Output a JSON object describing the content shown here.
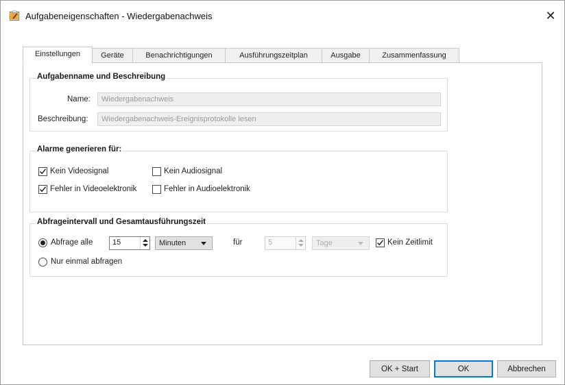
{
  "window": {
    "title": "Aufgabeneigenschaften - Wiedergabenachweis",
    "close_label": "✕"
  },
  "tabs": [
    {
      "label": "Einstellungen",
      "active": true
    },
    {
      "label": "Geräte",
      "active": false
    },
    {
      "label": "Benachrichtigungen",
      "active": false
    },
    {
      "label": "Ausführungszeitplan",
      "active": false
    },
    {
      "label": "Ausgabe",
      "active": false
    },
    {
      "label": "Zusammenfassung",
      "active": false
    }
  ],
  "task_group": {
    "title": "Aufgabenname und Beschreibung",
    "name_label": "Name:",
    "name_value": "Wiedergabenachweis",
    "description_label": "Beschreibung:",
    "description_value": "Wiedergabenachweis-Ereignisprotokolle lesen"
  },
  "alarms_group": {
    "title": "Alarme generieren für:",
    "options": [
      {
        "label": "Kein Videosignal",
        "checked": true
      },
      {
        "label": "Kein Audiosignal",
        "checked": false
      },
      {
        "label": "Fehler in Videoelektronik",
        "checked": true
      },
      {
        "label": "Fehler in Audioelektronik",
        "checked": false
      }
    ]
  },
  "interval_group": {
    "title": "Abfrageintervall und Gesamtausführungszeit",
    "poll_every_label": "Abfrage alle",
    "poll_every_selected": true,
    "interval_value": "15",
    "interval_unit": "Minuten",
    "for_label": "für",
    "duration_value": "5",
    "duration_unit": "Tage",
    "no_limit_label": "Kein Zeitlimit",
    "no_limit_checked": true,
    "poll_once_label": "Nur einmal abfragen",
    "poll_once_selected": false
  },
  "buttons": {
    "ok_start": "OK + Start",
    "ok": "OK",
    "cancel": "Abbrechen"
  },
  "colors": {
    "accent": "#0078d7",
    "icon_fill": "#e8a13a"
  }
}
